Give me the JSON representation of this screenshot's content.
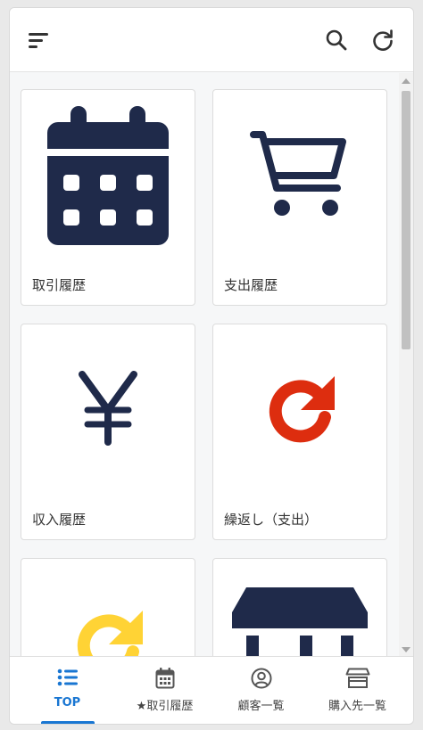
{
  "header": {
    "menu_icon": "sort-lines-icon",
    "search_icon": "search-icon",
    "refresh_icon": "refresh-icon"
  },
  "cards": [
    {
      "label": "取引履歴",
      "icon": "calendar-icon"
    },
    {
      "label": "支出履歴",
      "icon": "cart-icon"
    },
    {
      "label": "収入履歴",
      "icon": "yen-icon"
    },
    {
      "label": "繰返し（支出）",
      "icon": "redo-icon"
    },
    {
      "label": "",
      "icon": "redo-icon"
    },
    {
      "label": "",
      "icon": "store-icon"
    }
  ],
  "nav": [
    {
      "label": "TOP",
      "icon": "list-icon",
      "active": true
    },
    {
      "label": "★取引履歴",
      "icon": "calendar-icon"
    },
    {
      "label": "顧客一覧",
      "icon": "user-circle-icon"
    },
    {
      "label": "購入先一覧",
      "icon": "store-icon"
    }
  ],
  "colors": {
    "navy": "#1f2a4a",
    "red": "#dd2d0f",
    "yellow": "#ffd335",
    "accent": "#1976d2"
  }
}
